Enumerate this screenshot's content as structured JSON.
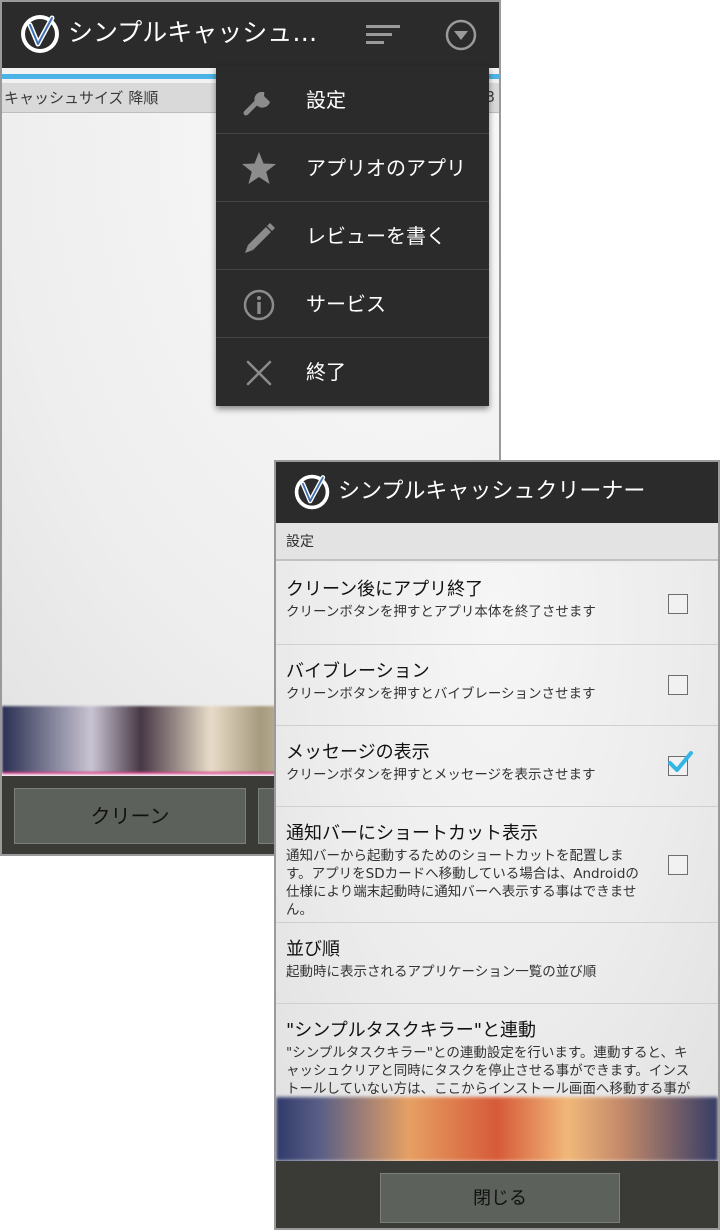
{
  "main_screen": {
    "app_title": "シンプルキャッシュク...",
    "sort_label": "キャッシュサイズ 降順",
    "sort_edge_text": "3",
    "clean_button": "クリーン",
    "colors": {
      "action_bar": "#2b2b2b",
      "accent_line": "#4bb3e6"
    }
  },
  "menu": {
    "items": [
      {
        "label": "設定",
        "icon": "wrench-icon"
      },
      {
        "label": "アプリオのアプリ",
        "icon": "star-icon"
      },
      {
        "label": "レビューを書く",
        "icon": "pencil-icon"
      },
      {
        "label": "サービス",
        "icon": "info-icon"
      },
      {
        "label": "終了",
        "icon": "close-icon"
      }
    ]
  },
  "settings_screen": {
    "title": "シンプルキャッシュクリーナー",
    "section_header": "設定",
    "prefs": [
      {
        "title": "クリーン後にアプリ終了",
        "summary": "クリーンボタンを押すとアプリ本体を終了させます",
        "checked": false
      },
      {
        "title": "バイブレーション",
        "summary": "クリーンボタンを押すとバイブレーションさせます",
        "checked": false
      },
      {
        "title": "メッセージの表示",
        "summary": "クリーンボタンを押すとメッセージを表示させます",
        "checked": true
      },
      {
        "title": "通知バーにショートカット表示",
        "summary": "通知バーから起動するためのショートカットを配置します。アプリをSDカードへ移動している場合は、Androidの仕様により端末起動時に通知バーへ表示する事はできません。",
        "checked": false
      },
      {
        "title": "並び順",
        "summary": "起動時に表示されるアプリケーション一覧の並び順"
      },
      {
        "title": "\"シンプルタスクキラー\"と連動",
        "summary": "\"シンプルタスクキラー\"との連動設定を行います。連動すると、キャッシュクリアと同時にタスクを停止させる事ができます。インストールしていない方は、ここからインストール画面へ移動する事ができます。"
      }
    ],
    "close_button": "閉じる",
    "colors": {
      "checkmark": "#33b5e5"
    }
  }
}
